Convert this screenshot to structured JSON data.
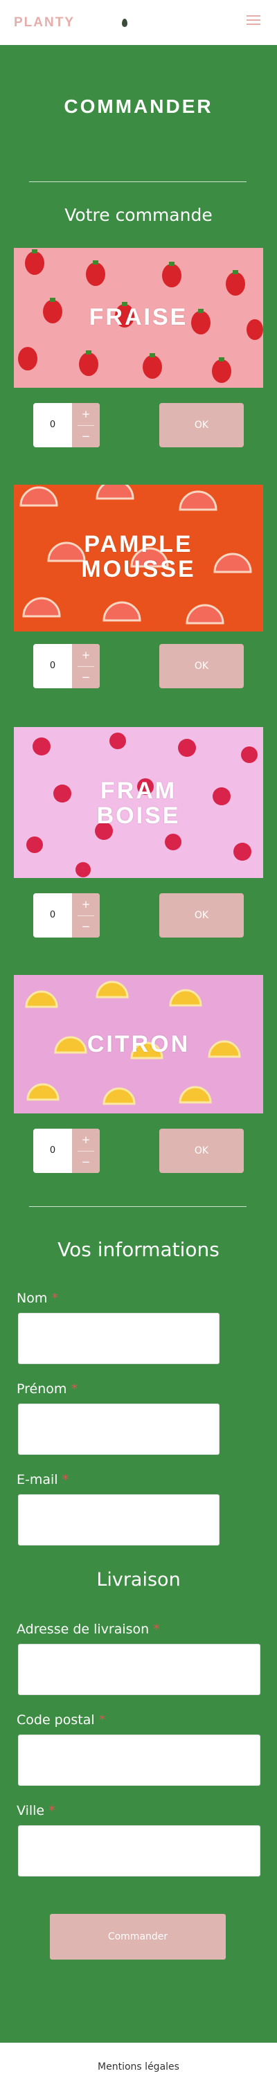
{
  "header": {
    "logo_text": "PLANTY",
    "menu_icon": "hamburger-menu-icon",
    "logo_color": "#e6aeaa"
  },
  "page": {
    "title": "COMMANDER",
    "background_color": "#3c8c43"
  },
  "order": {
    "heading": "Votre commande",
    "products": [
      {
        "name_line1": "FRAISE",
        "name_line2": "",
        "quantity": "0",
        "plus": "+",
        "minus": "−",
        "ok_label": "OK",
        "image": "strawberries-on-pink-image"
      },
      {
        "name_line1": "PAMPLE",
        "name_line2": "MOUSSE",
        "quantity": "0",
        "plus": "+",
        "minus": "−",
        "ok_label": "OK",
        "image": "grapefruit-on-orange-image"
      },
      {
        "name_line1": "FRAM",
        "name_line2": "BOISE",
        "quantity": "0",
        "plus": "+",
        "minus": "−",
        "ok_label": "OK",
        "image": "raspberries-on-pink-image"
      },
      {
        "name_line1": "CITRON",
        "name_line2": "",
        "quantity": "0",
        "plus": "+",
        "minus": "−",
        "ok_label": "OK",
        "image": "lemons-on-pink-image"
      }
    ],
    "button_color": "#dfb5b1"
  },
  "info": {
    "heading": "Vos informations",
    "fields": {
      "nom": {
        "label": "Nom",
        "required": "*",
        "value": ""
      },
      "prenom": {
        "label": "Prénom",
        "required": "*",
        "value": ""
      },
      "email": {
        "label": "E-mail",
        "required": "*",
        "value": ""
      }
    }
  },
  "delivery": {
    "heading": "Livraison",
    "fields": {
      "adresse": {
        "label": "Adresse de livraison",
        "required": "*",
        "value": ""
      },
      "code_postal": {
        "label": "Code postal",
        "required": "*",
        "value": ""
      },
      "ville": {
        "label": "Ville",
        "required": "*",
        "value": ""
      }
    }
  },
  "submit_label": "Commander",
  "footer": {
    "link": "Mentions légales"
  }
}
